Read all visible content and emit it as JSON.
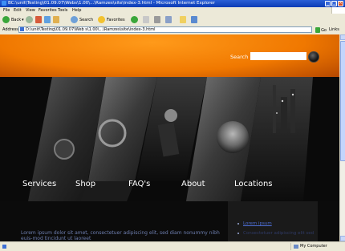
{
  "window": {
    "title": "BC:\\unit\\Testing\\01.09.07\\Webs\\1.00\\...\\Ramzes\\site\\index-3.html - Microsoft Internet Explorer"
  },
  "menu": [
    "File",
    "Edit",
    "View",
    "Favorites",
    "Tools",
    "Help"
  ],
  "toolbar": {
    "back_label": "Back",
    "search_label": "Search",
    "favorites_label": "Favorites"
  },
  "address": {
    "label": "Address",
    "value": "D:\\unit\\Testing\\01.09.07\\Web s\\1.00\\...\\Ramzes\\site\\index-3.html",
    "go_label": "Go",
    "links_label": "Links"
  },
  "header": {
    "search_label": "Search",
    "search_value": ""
  },
  "nav": [
    "Services",
    "Shop",
    "FAQ's",
    "About",
    "Locations"
  ],
  "content": {
    "lorem": "Lorem ipsum dolor sit amet, consectetuer adipiscing elit, sed diam nonummy nibh euis-mod tincidunt ut laoreet",
    "side_items": [
      "Lorem ipsum",
      "Consectetuer adipiscing elit sed"
    ]
  },
  "status": {
    "zone": "My Computer"
  },
  "colors": {
    "header_orange": "#f07800",
    "nav_text": "#ffffff",
    "link_blue": "#4c6cd0",
    "xp_blue": "#0b3bb5"
  }
}
